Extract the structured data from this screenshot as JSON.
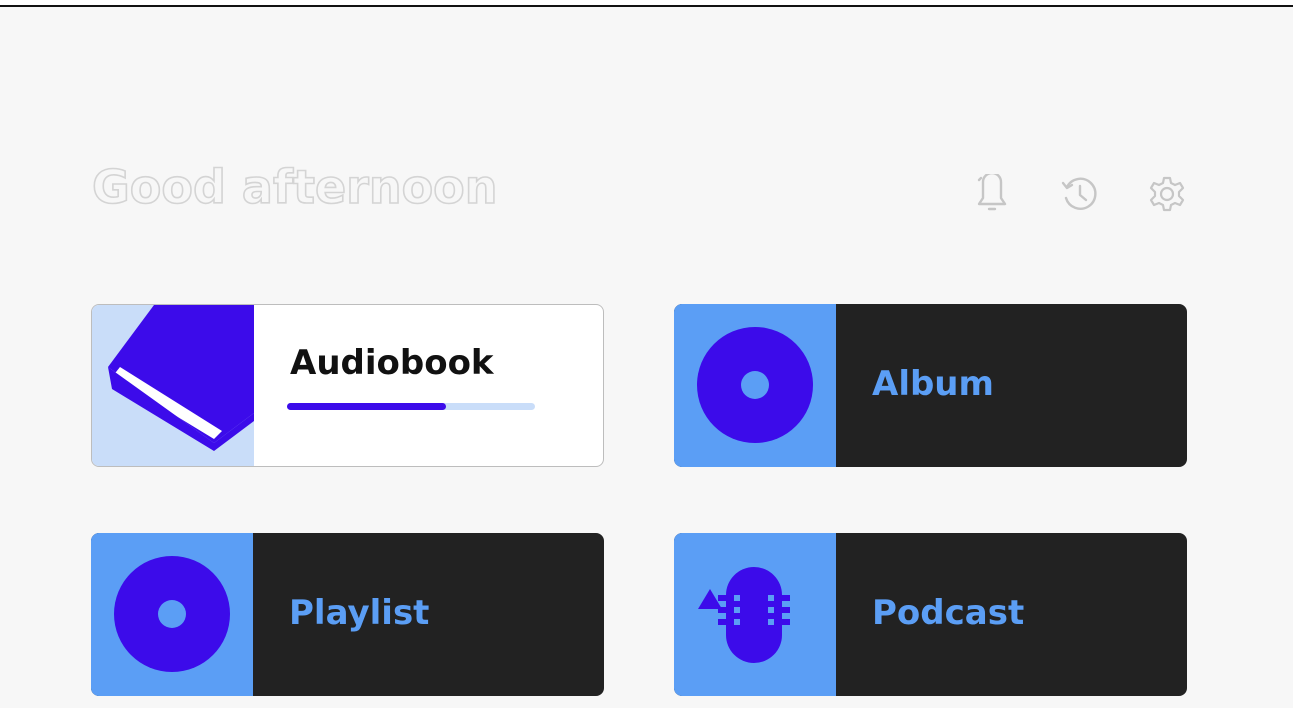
{
  "header": {
    "greeting": "Good afternoon",
    "icons": [
      "notifications-icon",
      "history-icon",
      "settings-icon"
    ]
  },
  "cards": [
    {
      "label": "Audiobook",
      "style": "light",
      "icon": "book-icon",
      "progress_fraction": 0.64
    },
    {
      "label": "Album",
      "style": "dark",
      "icon": "disc-icon"
    },
    {
      "label": "Playlist",
      "style": "dark",
      "icon": "disc-icon"
    },
    {
      "label": "Podcast",
      "style": "dark",
      "icon": "microphone-icon"
    }
  ],
  "colors": {
    "background": "#f7f7f7",
    "accent_blue": "#5b9ef5",
    "accent_purple": "#3c0bea",
    "dark_card": "#222222",
    "light_thumb": "#c9ddf9",
    "text_dark": "#111111",
    "icon_gray": "#c6c6c6"
  }
}
